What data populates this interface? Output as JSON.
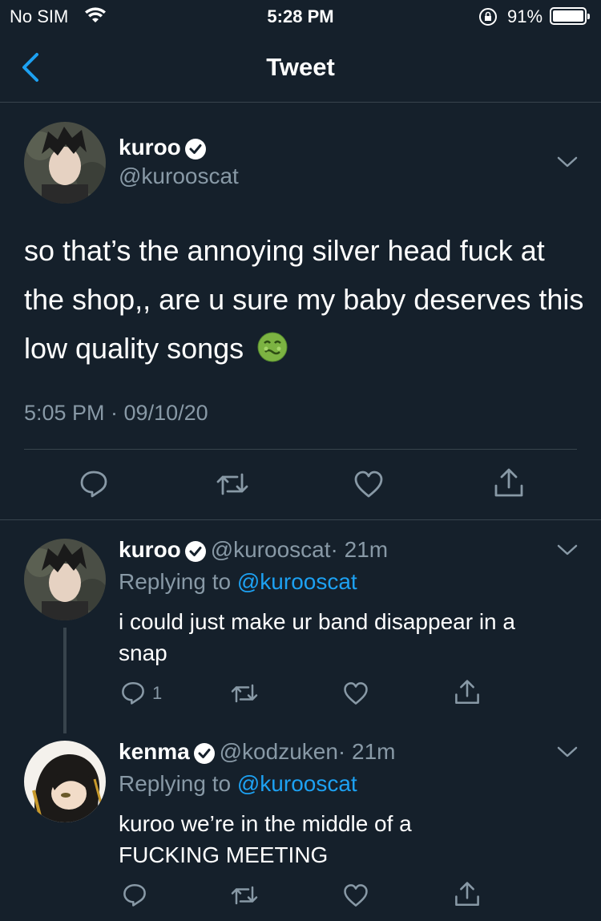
{
  "status_bar": {
    "carrier": "No SIM",
    "time": "5:28 PM",
    "battery": "91%"
  },
  "nav": {
    "title": "Tweet"
  },
  "main_tweet": {
    "name": "kuroo",
    "handle": "@kurooscat",
    "text": "so that’s the annoying silver head fuck at the shop,, are u sure my baby deserves this low quality songs",
    "emoji": "nauseated-face",
    "timestamp": "5:05 PM · 09/10/20"
  },
  "replies": [
    {
      "name": "kuroo",
      "handle": "@kurooscat",
      "age": "· 21m",
      "replying_to_prefix": "Replying to",
      "replying_to": "@kurooscat",
      "text": "i could just make ur band disappear in a snap",
      "reply_count": "1"
    },
    {
      "name": "kenma",
      "handle": "@kodzuken",
      "age": "· 21m",
      "replying_to_prefix": "Replying to",
      "replying_to": "@kurooscat",
      "text": "kuroo we’re in the middle of a FUCKING MEETING"
    }
  ],
  "colors": {
    "background": "#15202b",
    "accent": "#1da1f2",
    "muted": "#8899a6",
    "divider": "#38444d"
  }
}
